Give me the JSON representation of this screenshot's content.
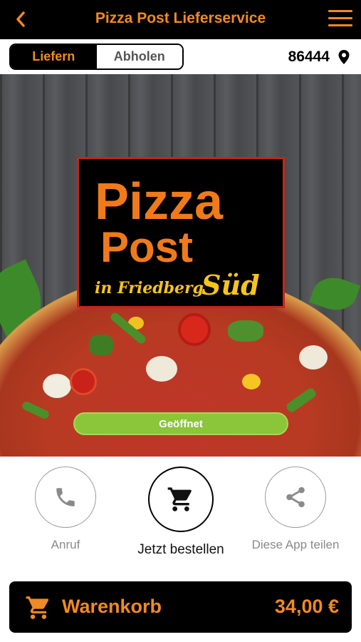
{
  "header": {
    "title": "Pizza Post Lieferservice",
    "back_icon": "chevron-left-icon",
    "menu_icon": "hamburger-menu-icon"
  },
  "mode": {
    "options": [
      "Liefern",
      "Abholen"
    ],
    "selected": "Liefern",
    "postal_code": "86444",
    "location_icon": "map-pin-icon"
  },
  "hero": {
    "logo": {
      "word1": "Pizza",
      "word2": "Post",
      "location": "in Friedberg",
      "suffix": "Süd"
    },
    "status": "Geöffnet"
  },
  "actions": [
    {
      "label": "Anruf",
      "icon": "phone-icon"
    },
    {
      "label": "Jetzt bestellen",
      "icon": "cart-icon"
    },
    {
      "label": "Diese App teilen",
      "icon": "share-icon"
    }
  ],
  "cart": {
    "label": "Warenkorb",
    "total": "34,00 €",
    "icon": "cart-icon"
  },
  "colors": {
    "accent": "#f08a24",
    "bar": "#000000",
    "status": "#8ac53a"
  }
}
